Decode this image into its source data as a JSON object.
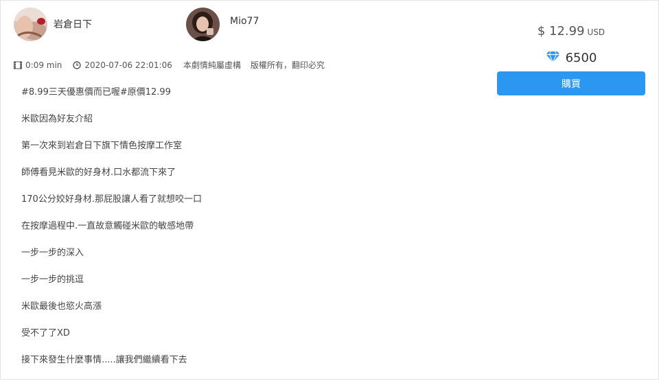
{
  "authors": [
    {
      "name": "岩倉日下",
      "avatar_icon": "studio-avatar"
    },
    {
      "name": "Mio77",
      "avatar_icon": "actor-avatar"
    }
  ],
  "meta": {
    "duration": "0:09 min",
    "datetime": "2020-07-06 22:01:06",
    "notice_fiction": "本劇情純屬虛構",
    "notice_copyright": "版權所有，翻印必究",
    "duration_icon": "film-icon",
    "datetime_icon": "clock-icon"
  },
  "description_lines": [
    "#8.99三天優惠價而已喔#原價12.99",
    "米歐因為好友介紹",
    "第一次來到岩倉日下旗下情色按摩工作室",
    "師傅看見米歐的好身材.口水都流下來了",
    "170公分姣好身材.那屁股讓人看了就想咬一口",
    "在按摩過程中.一直故意觸碰米歐的敏感地帶",
    "一步一步的深入",
    "一步一步的挑逗",
    "米歐最後也慾火高漲",
    "受不了了XD",
    "接下來發生什麼事情.....讓我們繼續看下去"
  ],
  "pricing": {
    "usd_amount": "$ 12.99",
    "usd_currency": "USD",
    "diamond_amount": "6500",
    "diamond_icon": "diamond-icon",
    "diamond_color": "#2b97f1"
  },
  "buy_button": {
    "label": "購買",
    "color": "#2b97f1"
  }
}
